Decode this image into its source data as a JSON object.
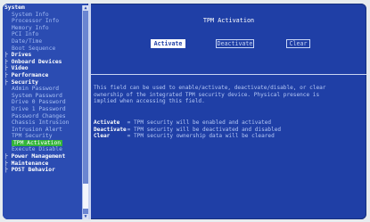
{
  "sidebar": {
    "items": [
      {
        "label": "System",
        "level": "top"
      },
      {
        "label": "System Info",
        "level": "sub"
      },
      {
        "label": "Processor Info",
        "level": "sub"
      },
      {
        "label": "Memory Info",
        "level": "sub"
      },
      {
        "label": "PCI Info",
        "level": "sub"
      },
      {
        "label": "Date/Time",
        "level": "sub"
      },
      {
        "label": "Boot Sequence",
        "level": "sub"
      },
      {
        "label": "Drives",
        "level": "top"
      },
      {
        "label": "Onboard Devices",
        "level": "top"
      },
      {
        "label": "Video",
        "level": "top"
      },
      {
        "label": "Performance",
        "level": "top"
      },
      {
        "label": "Security",
        "level": "top"
      },
      {
        "label": "Admin Password",
        "level": "sub2"
      },
      {
        "label": "System Password",
        "level": "sub2"
      },
      {
        "label": "Drive 0 Password",
        "level": "sub2"
      },
      {
        "label": "Drive 1 Password",
        "level": "sub2"
      },
      {
        "label": "Password Changes",
        "level": "sub2"
      },
      {
        "label": "Chassis Intrusion",
        "level": "sub2"
      },
      {
        "label": "Intrusion Alert",
        "level": "sub2"
      },
      {
        "label": "TPM Security",
        "level": "sub2"
      },
      {
        "label": "TPM Activation",
        "level": "selected"
      },
      {
        "label": "Execute Disable",
        "level": "sub2"
      },
      {
        "label": "Power Management",
        "level": "top"
      },
      {
        "label": "Maintenance",
        "level": "top"
      },
      {
        "label": "POST Behavior",
        "level": "top"
      }
    ]
  },
  "main": {
    "title": "TPM Activation",
    "buttons": {
      "activate": "Activate",
      "deactivate": "Deactivate",
      "clear": "Clear"
    },
    "help_lines": [
      "This field can be used to enable/activate, deactivate/disable, or clear",
      "ownership of the integrated TPM security device.  Physical presence is",
      "implied when accessing this field."
    ],
    "legend": [
      {
        "term": "Activate",
        "desc": "= TPM security will be enabled and activated"
      },
      {
        "term": "Deactivate",
        "desc": "= TPM security will be deactivated and disabled"
      },
      {
        "term": "Clear",
        "desc": "= TPM security ownership data will be cleared"
      }
    ]
  },
  "colors": {
    "background": "#1f3fa6",
    "selection": "#34b53a",
    "text": "#ffffff",
    "dim_text": "#b5c8f6"
  }
}
